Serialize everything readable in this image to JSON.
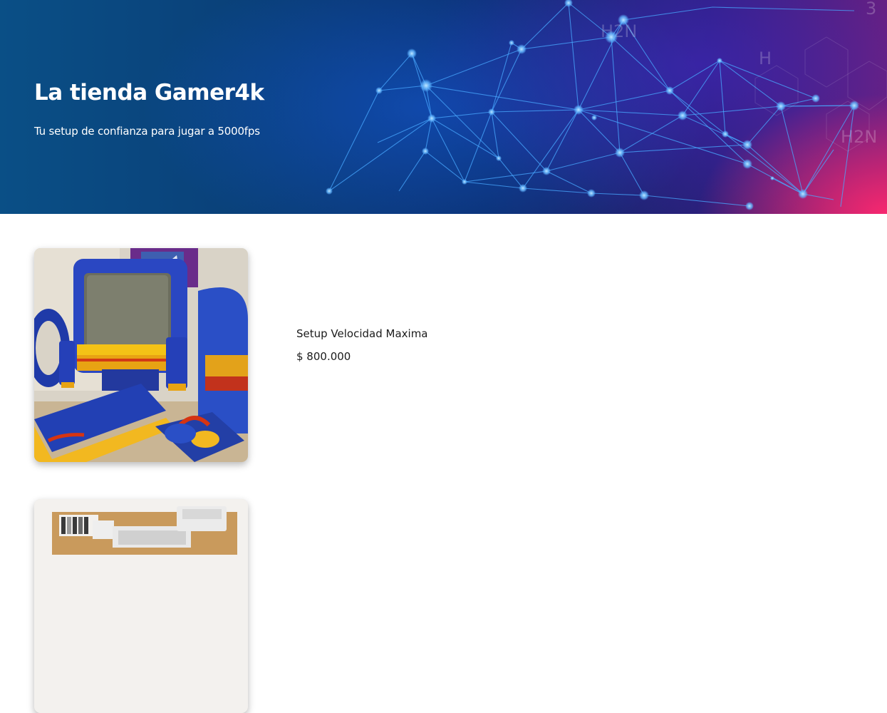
{
  "hero": {
    "title": "La tienda Gamer4k",
    "subtitle": "Tu setup de confianza para jugar a 5000fps",
    "colors": {
      "left": "#0a4f86",
      "middle": "#0b2f6e",
      "right_accent": "#ff286e",
      "network_lines": "#3fa0ff"
    }
  },
  "products": [
    {
      "name": "Setup Velocidad Maxima",
      "price": "$ 800.000",
      "image": "retro-hot-wheels-computer-setup"
    },
    {
      "image": "desk-with-printer-setup"
    }
  ]
}
